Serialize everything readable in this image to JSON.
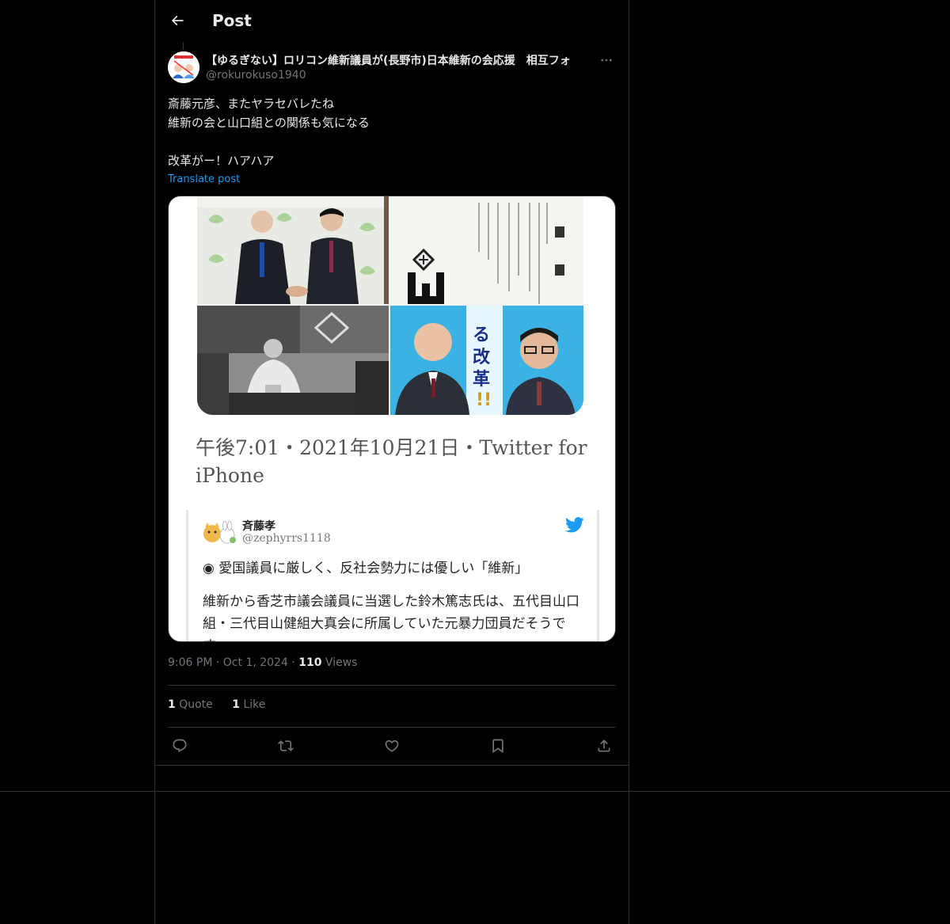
{
  "header": {
    "title": "Post",
    "back_icon": "arrow-left-icon"
  },
  "post": {
    "author": {
      "display_name": "【ゆるぎない】ロリコン維新議員が(長野市)日本維新の会応援　相互フォ",
      "handle": "@rokurokuso1940"
    },
    "text_lines": [
      "斎藤元彦、またヤラセバレたね",
      "維新の会と山口組との関係も気になる",
      "",
      "改革がー！ハアハア"
    ],
    "translate_label": "Translate post",
    "media": {
      "timestamp_text": "午後7:01・2021年10月21日・Twitter for iPhone",
      "quoted_tweet": {
        "name": "斉藤孝",
        "handle": "@zephyrrs1118",
        "paragraph1": "◉ 愛国議員に厳しく、反社会勢力には優しい「維新」",
        "paragraph2": "維新から香芝市議会議員に当選した鈴木篤志氏は、五代目山口組・三代目山健組大真会に所属していた元暴力団員だそうです。"
      }
    },
    "time": "9:06 PM",
    "date": "Oct 1, 2024",
    "views_count": "110",
    "views_label": "Views",
    "quote_count": "1",
    "quote_label": "Quote",
    "like_count": "1",
    "like_label": "Like",
    "actions": [
      "reply-icon",
      "repost-icon",
      "like-icon",
      "bookmark-icon",
      "share-icon"
    ]
  },
  "colors": {
    "background": "#000000",
    "text": "#e7e9ea",
    "secondary": "#71767b",
    "accent": "#1d9bf0",
    "border": "#2f3336"
  }
}
